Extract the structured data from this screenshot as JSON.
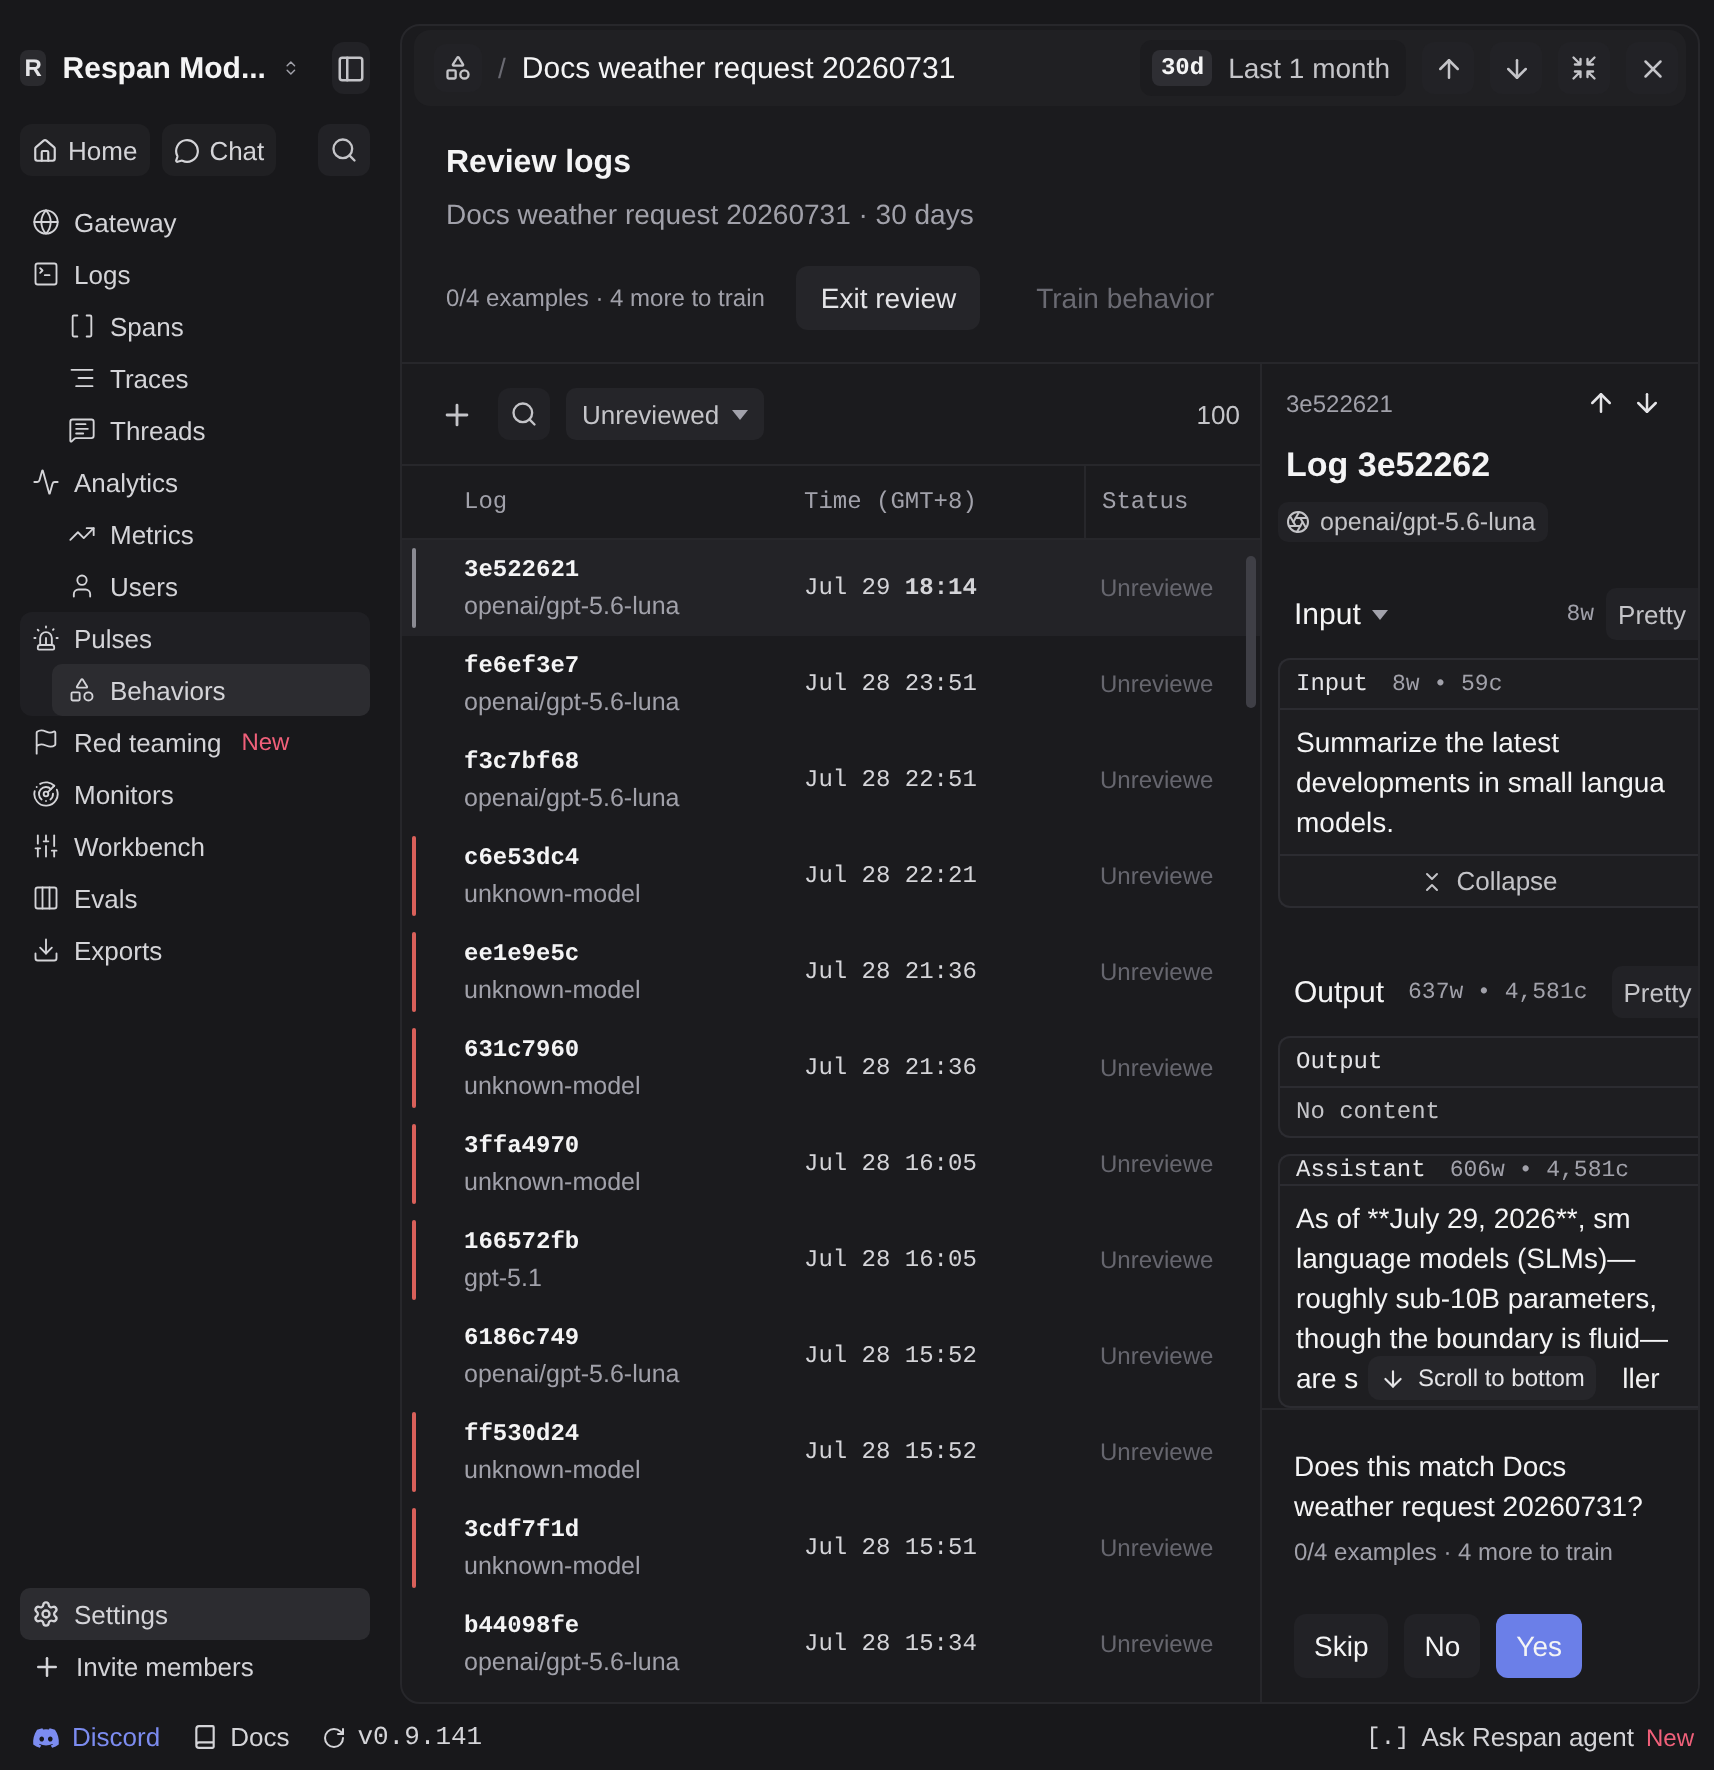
{
  "workspace": {
    "initial": "R",
    "name": "Respan Mod..."
  },
  "quick_nav": [
    {
      "label": "Home"
    },
    {
      "label": "Chat"
    }
  ],
  "nav": [
    {
      "label": "Gateway",
      "selected": false
    },
    {
      "label": "Logs",
      "selected": false,
      "children": [
        {
          "label": "Spans",
          "selected": false
        },
        {
          "label": "Traces",
          "selected": false
        },
        {
          "label": "Threads",
          "selected": false
        }
      ]
    },
    {
      "label": "Analytics",
      "selected": false,
      "children": [
        {
          "label": "Metrics",
          "selected": false
        },
        {
          "label": "Users",
          "selected": false
        }
      ]
    },
    {
      "label": "Pulses",
      "selected": false,
      "children": [
        {
          "label": "Behaviors",
          "selected": true
        }
      ]
    },
    {
      "label": "Red teaming",
      "selected": false,
      "badge": "New"
    },
    {
      "label": "Monitors",
      "selected": false
    },
    {
      "label": "Workbench",
      "selected": false
    },
    {
      "label": "Evals",
      "selected": false
    },
    {
      "label": "Exports",
      "selected": false
    }
  ],
  "footer_nav": [
    {
      "label": "Settings"
    },
    {
      "label": "Invite members"
    }
  ],
  "header": {
    "separator": "/",
    "breadcrumb": "Docs weather request 20260731",
    "range_badge": "30d",
    "range_label": "Last 1 month"
  },
  "review": {
    "title": "Review logs",
    "subtitle": "Docs weather request 20260731 · 30 days",
    "progress": "0/4 examples · 4 more to train",
    "buttons": [
      {
        "label": "Exit review",
        "disabled": false
      },
      {
        "label": "Train behavior",
        "disabled": true
      }
    ]
  },
  "table": {
    "filter": "Unreviewed",
    "count": "100",
    "columns": [
      "Log",
      "Time (GMT+8)",
      "Status"
    ],
    "rows": [
      {
        "id": "3e522621",
        "model": "openai/gpt-5.6-luna",
        "time": "Jul 29 **18:14**",
        "status": "Unreviewe",
        "selected": true
      },
      {
        "id": "fe6ef3e7",
        "model": "openai/gpt-5.6-luna",
        "time": "Jul 28 23:51",
        "status": "Unreviewe",
        "selected": false
      },
      {
        "id": "f3c7bf68",
        "model": "openai/gpt-5.6-luna",
        "time": "Jul 28 22:51",
        "status": "Unreviewe",
        "selected": false
      },
      {
        "id": "c6e53dc4",
        "model": "unknown-model",
        "time": "Jul 28 22:21",
        "status": "Unreviewe",
        "selected": false,
        "color": "#d9605a"
      },
      {
        "id": "ee1e9e5c",
        "model": "unknown-model",
        "time": "Jul 28 21:36",
        "status": "Unreviewe",
        "selected": false,
        "color": "#d9605a"
      },
      {
        "id": "631c7960",
        "model": "unknown-model",
        "time": "Jul 28 21:36",
        "status": "Unreviewe",
        "selected": false,
        "color": "#d9605a"
      },
      {
        "id": "3ffa4970",
        "model": "unknown-model",
        "time": "Jul 28 16:05",
        "status": "Unreviewe",
        "selected": false,
        "color": "#d9605a"
      },
      {
        "id": "166572fb",
        "model": "gpt-5.1",
        "time": "Jul 28 16:05",
        "status": "Unreviewe",
        "selected": false,
        "color": "#d9605a"
      },
      {
        "id": "6186c749",
        "model": "openai/gpt-5.6-luna",
        "time": "Jul 28 15:52",
        "status": "Unreviewe",
        "selected": false
      },
      {
        "id": "ff530d24",
        "model": "unknown-model",
        "time": "Jul 28 15:52",
        "status": "Unreviewe",
        "selected": false,
        "color": "#d9605a"
      },
      {
        "id": "3cdf7f1d",
        "model": "unknown-model",
        "time": "Jul 28 15:51",
        "status": "Unreviewe",
        "selected": false,
        "color": "#d9605a"
      },
      {
        "id": "b44098fe",
        "model": "openai/gpt-5.6-luna",
        "time": "Jul 28 15:34",
        "status": "Unreviewe",
        "selected": false
      }
    ]
  },
  "detail": {
    "id": "3e522621",
    "title": "Log 3e52262",
    "model": "openai/gpt-5.6-luna",
    "input": {
      "label": "Input",
      "words": "8w",
      "format": "Pretty",
      "block": {
        "label": "Input",
        "stats": "8w • 59c",
        "lines": [
          "Summarize the latest",
          "developments in small langua",
          "models."
        ],
        "collapse": "Collapse"
      }
    },
    "output": {
      "label": "Output",
      "stats": "637w • 4,581c",
      "format": "Pretty",
      "empty_block": {
        "label": "Output",
        "text": "No content"
      },
      "message": {
        "label": "Assistant",
        "stats": "606w • 4,581c",
        "lines": [
          "As of **July 29, 2026**, sm",
          "language models (SLMs)—",
          "roughly sub-10B parameters,",
          "though the boundary is fluid—"
        ],
        "tail": [
          "are s",
          "ller"
        ],
        "scroll_button": "Scroll to bottom"
      }
    },
    "question": "Does this match Docs weather request 20260731?",
    "progress": "0/4 examples · 4 more to train",
    "answers": [
      {
        "label": "Skip",
        "kind": "secondary"
      },
      {
        "label": "No",
        "kind": "secondary"
      },
      {
        "label": "Yes",
        "kind": "primary"
      }
    ]
  },
  "bottom_bar": {
    "links": [
      {
        "label": "Discord",
        "kind": "discord"
      },
      {
        "label": "Docs",
        "kind": "docs"
      },
      {
        "label": "v0.9.141",
        "kind": "version"
      }
    ],
    "agent": {
      "mark": "[.]",
      "label": "Ask Respan agent",
      "badge": "New"
    }
  }
}
